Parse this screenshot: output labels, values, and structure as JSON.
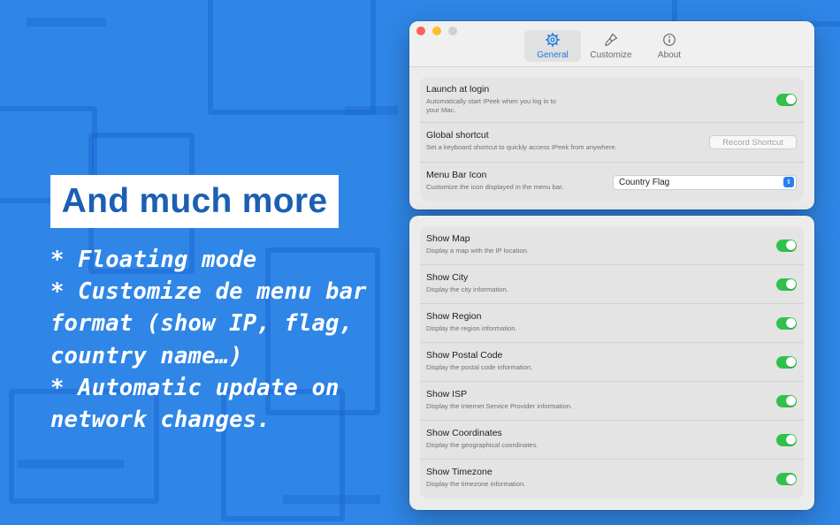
{
  "promo": {
    "headline": "And much more",
    "bullets": [
      "* Floating mode",
      "* Customize de menu bar format (show IP, flag, country name…)",
      "* Automatic update on network changes."
    ]
  },
  "window": {
    "tabs": [
      {
        "label": "General",
        "icon": "gear-icon",
        "active": true
      },
      {
        "label": "Customize",
        "icon": "paintbrush-icon",
        "active": false
      },
      {
        "label": "About",
        "icon": "info-icon",
        "active": false
      }
    ],
    "general": {
      "launch_at_login": {
        "title": "Launch at login",
        "desc_line1": "Automatically start IPeek when you log in to",
        "desc_line2": "your Mac.",
        "enabled": true
      },
      "global_shortcut": {
        "title": "Global shortcut",
        "desc": "Set a keyboard shortcut to quickly access IPeek from anywhere.",
        "button": "Record Shortcut"
      },
      "menu_bar_icon": {
        "title": "Menu Bar Icon",
        "desc": "Customize the icon displayed in the menu bar.",
        "selected": "Country Flag"
      }
    },
    "display_options": [
      {
        "title": "Show Map",
        "desc": "Display a map with the IP location.",
        "enabled": true
      },
      {
        "title": "Show City",
        "desc": "Display the city information.",
        "enabled": true
      },
      {
        "title": "Show Region",
        "desc": "Display the region information.",
        "enabled": true
      },
      {
        "title": "Show Postal Code",
        "desc": "Display the postal code information.",
        "enabled": true
      },
      {
        "title": "Show ISP",
        "desc": "Display the Internet Service Provider information.",
        "enabled": true
      },
      {
        "title": "Show Coordinates",
        "desc": "Display the geographical coordinates.",
        "enabled": true
      },
      {
        "title": "Show Timezone",
        "desc": "Display the timezone information.",
        "enabled": true
      }
    ]
  },
  "colors": {
    "background": "#2f86e6",
    "headline_text": "#1c5fb3",
    "toggle_on": "#30c14a",
    "accent": "#1f7ae0"
  }
}
